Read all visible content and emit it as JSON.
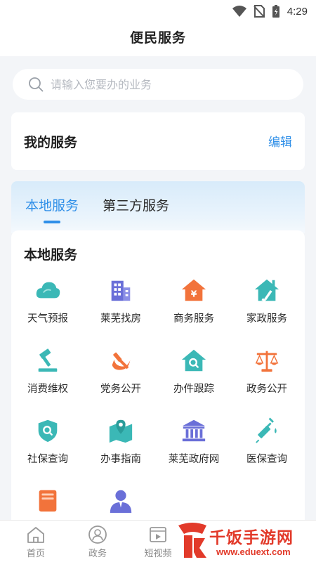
{
  "status_bar": {
    "time": "4:29"
  },
  "header": {
    "title": "便民服务"
  },
  "search": {
    "placeholder": "请输入您要办的业务"
  },
  "my_services": {
    "title": "我的服务",
    "edit_label": "编辑"
  },
  "tabs": [
    {
      "label": "本地服务",
      "active": true
    },
    {
      "label": "第三方服务",
      "active": false
    }
  ],
  "local_services": {
    "title": "本地服务",
    "items": [
      {
        "label": "天气预报",
        "icon": "weather-icon"
      },
      {
        "label": "莱芜找房",
        "icon": "building-icon"
      },
      {
        "label": "商务服务",
        "icon": "business-icon"
      },
      {
        "label": "家政服务",
        "icon": "housekeeping-icon"
      },
      {
        "label": "消费维权",
        "icon": "gavel-icon"
      },
      {
        "label": "党务公开",
        "icon": "party-icon"
      },
      {
        "label": "办件跟踪",
        "icon": "tracking-icon"
      },
      {
        "label": "政务公开",
        "icon": "scale-icon"
      },
      {
        "label": "社保查询",
        "icon": "social-security-icon"
      },
      {
        "label": "办事指南",
        "icon": "guide-map-icon"
      },
      {
        "label": "莱芜政府网",
        "icon": "government-icon"
      },
      {
        "label": "医保查询",
        "icon": "syringe-icon"
      },
      {
        "label": "",
        "icon": "book-icon"
      },
      {
        "label": "",
        "icon": "person-icon"
      }
    ]
  },
  "bottom_nav": [
    {
      "label": "首页",
      "icon": "home-icon"
    },
    {
      "label": "政务",
      "icon": "government-affairs-icon"
    },
    {
      "label": "短视频",
      "icon": "video-icon"
    }
  ],
  "watermark": {
    "text": "千饭手游网",
    "url": "www.eduext.com"
  },
  "colors": {
    "accent": "#2f8fe8",
    "teal": "#3bb8b6",
    "purple": "#6a6fd8",
    "orange": "#f2733b",
    "red": "#e23a2a"
  }
}
